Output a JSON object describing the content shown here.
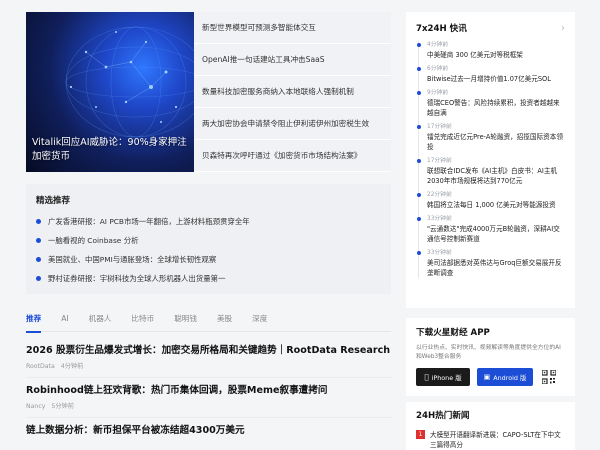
{
  "hero": {
    "feature_title": "Vitalik回应AI威胁论：90%身家押注加密货币",
    "items": [
      "新型世界模型可预测多智能体交互",
      "OpenAI推一句话建站工具冲击SaaS",
      "数量科技加密服务商纳入本地联络人强制机制",
      "两大加密协会申请禁令阻止伊利诺伊州加密税生效",
      "贝森特再次呼吁通过《加密货币市场结构法案》"
    ]
  },
  "recommended": {
    "title": "精选推荐",
    "items": [
      "广发香港研报：AI PCB市场一年翻倍，上游材料瓶颈贯穿全年",
      "一脑看视的 Coinbase 分析",
      "美国就业、中国PMI与通胀登场：全球增长韧性观察",
      "野村证券研报：宇树科技为全球人形机器人出货量第一"
    ]
  },
  "tabs": [
    "推荐",
    "AI",
    "机器人",
    "比特币",
    "聪明钱",
    "美股",
    "深度"
  ],
  "articles": [
    {
      "title": "2026 股票衍生品爆发式增长：加密交易所格局和关键趋势｜RootData Research",
      "source": "RootData",
      "time": "4分钟前"
    },
    {
      "title": "Robinhood链上狂欢背歌：热门币集体回调，股票Meme叙事遭拷问",
      "source": "Nancy",
      "time": "5分钟前"
    },
    {
      "title": "链上数据分析：新币担保平台被冻结超4300万美元",
      "source": "",
      "time": ""
    }
  ],
  "flash": {
    "title": "7x24H 快讯",
    "items": [
      {
        "time": "4分钟前",
        "text": "中美磋商 300 亿美元对等税框架"
      },
      {
        "time": "6分钟前",
        "text": "Bitwise过去一月增持价值1.07亿美元SOL"
      },
      {
        "time": "9分钟前",
        "text": "德瑞CEO警告：风险持续累积，投资者越越来越自满"
      },
      {
        "time": "17分钟前",
        "text": "镭兑完成近亿元Pre-A轮融资，招揽国际资本领投"
      },
      {
        "time": "17分钟前",
        "text": "联想联合IDC发布《AI主机》白皮书：AI主机2030年市场规模将达到770亿元"
      },
      {
        "time": "22分钟前",
        "text": "韩国将立法每日 1,000 亿美元对等能源投资"
      },
      {
        "time": "33分钟前",
        "text": "\"云通数达\"完成4000万元B轮融资，深耕AI交通信号控制新赛道"
      },
      {
        "time": "33分钟前",
        "text": "美司法部据悉对英伟达与Groq巨额交易展开反垄断调查"
      }
    ]
  },
  "app": {
    "title": "下载火星财经 APP",
    "desc": "以行业热点、实时快讯、视频解读等角度提供全方位的AI和Web3整合服务",
    "ios_label": "iPhone 版",
    "android_label": "Android 版"
  },
  "hot": {
    "title": "24H热门新闻",
    "items": [
      {
        "rank": "1",
        "text": "大模型开语翻译新进展：CAPO-SLT在下中文三篇得高分"
      }
    ]
  },
  "colors": {
    "accent": "#1b4dd6",
    "hot_rank": "#e02f2f"
  }
}
